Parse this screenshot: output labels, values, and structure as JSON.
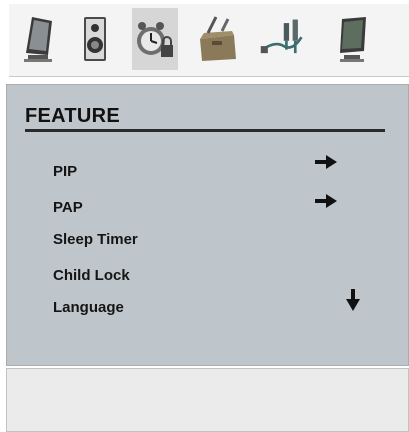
{
  "tabs": [
    {
      "icon": "monitor-icon"
    },
    {
      "icon": "speaker-icon"
    },
    {
      "icon": "alarm-clock-lock-icon",
      "selected": true
    },
    {
      "icon": "toolbox-icon"
    },
    {
      "icon": "cable-connector-icon"
    },
    {
      "icon": "screen-settings-icon"
    }
  ],
  "menu": {
    "title": "FEATURE",
    "items": [
      {
        "label": "PIP",
        "indicator": "arrow-right"
      },
      {
        "label": "PAP",
        "indicator": "arrow-right"
      },
      {
        "label": "Sleep Timer"
      },
      {
        "label": "Child Lock"
      },
      {
        "label": "Language",
        "indicator": "arrow-down"
      }
    ]
  },
  "colors": {
    "panel_bg": "#bfc6cb",
    "selected_tab_bg": "#d6d6d6",
    "text": "#151515"
  }
}
